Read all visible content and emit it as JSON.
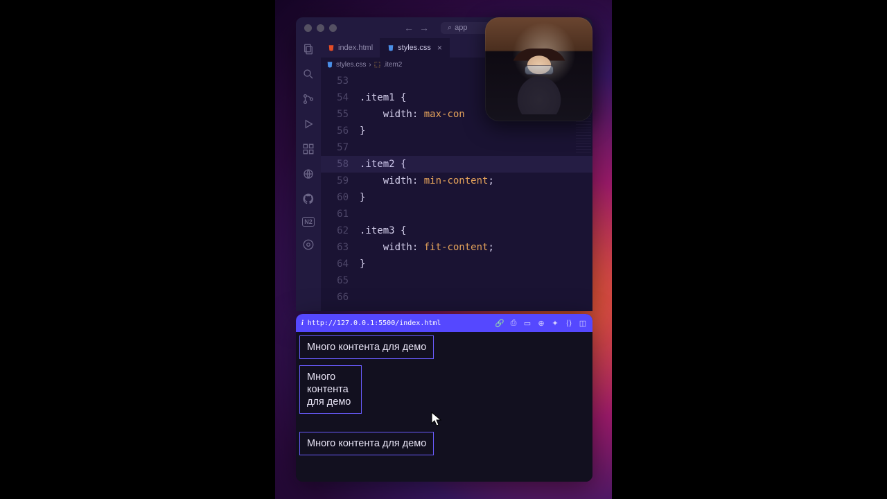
{
  "search": {
    "placeholder": "app"
  },
  "tabs": [
    {
      "label": "index.html",
      "icon": "html",
      "active": false
    },
    {
      "label": "styles.css",
      "icon": "css",
      "active": true,
      "dirty": true
    }
  ],
  "breadcrumb": {
    "file": "styles.css",
    "symbol": ".item2"
  },
  "gutter_start": 53,
  "code_lines": [
    {
      "text": ""
    },
    {
      "tokens": [
        {
          "t": ".item1 ",
          "c": "sel"
        },
        {
          "t": "{",
          "c": "punc"
        }
      ]
    },
    {
      "tokens": [
        {
          "t": "    ",
          "c": "punc"
        },
        {
          "t": "width",
          "c": "prop"
        },
        {
          "t": ": ",
          "c": "punc"
        },
        {
          "t": "max-con",
          "c": "val"
        }
      ],
      "truncated": true
    },
    {
      "tokens": [
        {
          "t": "}",
          "c": "punc"
        }
      ]
    },
    {
      "text": ""
    },
    {
      "tokens": [
        {
          "t": ".item2 ",
          "c": "sel"
        },
        {
          "t": "{",
          "c": "punc"
        }
      ],
      "highlight": true
    },
    {
      "tokens": [
        {
          "t": "    ",
          "c": "punc"
        },
        {
          "t": "width",
          "c": "prop"
        },
        {
          "t": ": ",
          "c": "punc"
        },
        {
          "t": "min-content",
          "c": "val"
        },
        {
          "t": ";",
          "c": "punc"
        }
      ]
    },
    {
      "tokens": [
        {
          "t": "}",
          "c": "punc"
        }
      ]
    },
    {
      "text": ""
    },
    {
      "tokens": [
        {
          "t": ".item3 ",
          "c": "sel"
        },
        {
          "t": "{",
          "c": "punc"
        }
      ]
    },
    {
      "tokens": [
        {
          "t": "    ",
          "c": "punc"
        },
        {
          "t": "width",
          "c": "prop"
        },
        {
          "t": ": ",
          "c": "punc"
        },
        {
          "t": "fit-content",
          "c": "val"
        },
        {
          "t": ";",
          "c": "punc"
        }
      ]
    },
    {
      "tokens": [
        {
          "t": "}",
          "c": "punc"
        }
      ]
    },
    {
      "text": ""
    },
    {
      "text": ""
    }
  ],
  "preview": {
    "url": "http://127.0.0.1:5500/index.html",
    "items": [
      "Много контента для демо",
      "Много контента для демо",
      "Много контента для демо"
    ]
  },
  "activity_icons": [
    "files",
    "search",
    "git",
    "debug",
    "extensions",
    "remote",
    "github",
    "logo",
    "settings"
  ]
}
